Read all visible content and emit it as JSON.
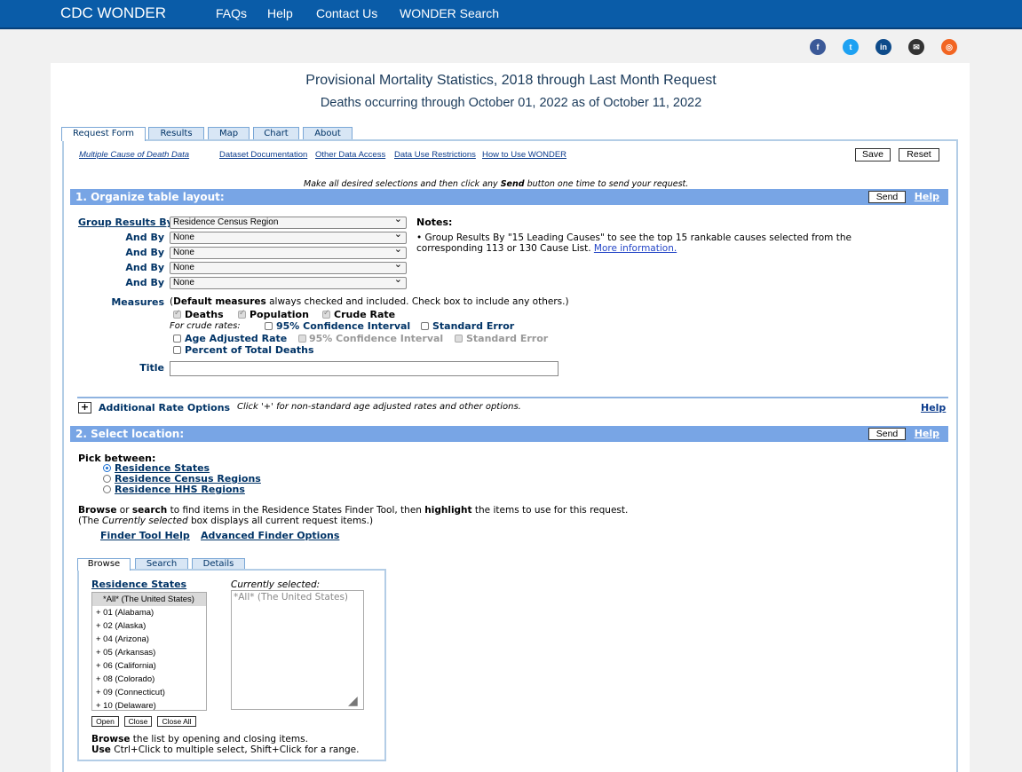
{
  "nav": {
    "brand": "CDC WONDER",
    "links": [
      "FAQs",
      "Help",
      "Contact Us",
      "WONDER Search"
    ]
  },
  "social": [
    {
      "name": "facebook-icon",
      "glyph": "f",
      "color": "#3b5998"
    },
    {
      "name": "twitter-icon",
      "glyph": "t",
      "color": "#1da1f2"
    },
    {
      "name": "linkedin-icon",
      "glyph": "in",
      "color": "#0e4b8a"
    },
    {
      "name": "email-icon",
      "glyph": "✉",
      "color": "#333333"
    },
    {
      "name": "rss-icon",
      "glyph": "◎",
      "color": "#f26522"
    }
  ],
  "title": "Provisional Mortality Statistics, 2018 through Last Month Request",
  "subtitle": "Deaths occurring through October 01, 2022 as of October 11, 2022",
  "tabs": [
    "Request Form",
    "Results",
    "Map",
    "Chart",
    "About"
  ],
  "toplinks": [
    "Multiple Cause of Death Data",
    "Dataset Documentation",
    "Other Data Access",
    "Data Use Restrictions",
    "How to Use WONDER"
  ],
  "buttons": {
    "save": "Save",
    "reset": "Reset",
    "send": "Send",
    "help": "Help"
  },
  "instruction_pre": "Make all desired selections and then click any ",
  "instruction_bold": "Send",
  "instruction_post": " button one time to send your request.",
  "section1": {
    "title": "1. Organize table layout:",
    "group_label": "Group Results By",
    "and_label": "And By",
    "group_value": "Residence Census Region",
    "and_values": [
      "None",
      "None",
      "None",
      "None"
    ],
    "notes_label": "Notes:",
    "note_text": "• Group Results By \"15 Leading Causes\" to see the top 15 rankable causes selected from the corresponding 113 or 130 Cause List.",
    "note_link": "More information.",
    "measures_label": "Measures",
    "measures_desc_bold": "Default measures",
    "measures_desc": " always checked and included. Check box to include any others.)",
    "m_deaths": "Deaths",
    "m_population": "Population",
    "m_crude": "Crude Rate",
    "for_crude": "For crude rates:",
    "m_ci": "95% Confidence Interval",
    "m_se": "Standard Error",
    "m_age": "Age Adjusted Rate",
    "m_ci2": "95% Confidence Interval",
    "m_se2": "Standard Error",
    "m_pct": "Percent of Total Deaths",
    "title_label": "Title",
    "title_value": ""
  },
  "additional": {
    "plus": "+",
    "label": "Additional Rate Options",
    "desc": "Click '+' for non-standard age adjusted rates and other options."
  },
  "section2": {
    "title": "2. Select location:",
    "pick": "Pick between:",
    "options": [
      "Residence States",
      "Residence Census Regions",
      "Residence HHS Regions"
    ],
    "browse_b1": "Browse",
    "browse_t1": " or ",
    "browse_b2": "search",
    "browse_t2": " to find items in the Residence States Finder Tool, then ",
    "browse_b3": "highlight",
    "browse_t3": " the items to use for this request.",
    "line2_a": "(The ",
    "line2_i": "Currently selected",
    "line2_b": " box displays all current request items.)",
    "link1": "Finder Tool Help",
    "link2": "Advanced Finder Options",
    "ftabs": [
      "Browse",
      "Search",
      "Details"
    ],
    "list_title": "Residence States",
    "items": [
      "*All*  (The United States)",
      "+ 01  (Alabama)",
      "+ 02  (Alaska)",
      "+ 04  (Arizona)",
      "+ 05  (Arkansas)",
      "+ 06  (California)",
      "+ 08  (Colorado)",
      "+ 09  (Connecticut)",
      "+ 10  (Delaware)"
    ],
    "cur_label": "Currently selected:",
    "cur_value": "*All*  (The United States)",
    "list_btns": [
      "Open",
      "Close",
      "Close All"
    ],
    "foot1_b": "Browse",
    "foot1": " the list by opening and closing items.",
    "foot2_b": "Use",
    "foot2": " Ctrl+Click to multiple select, Shift+Click for a range."
  }
}
